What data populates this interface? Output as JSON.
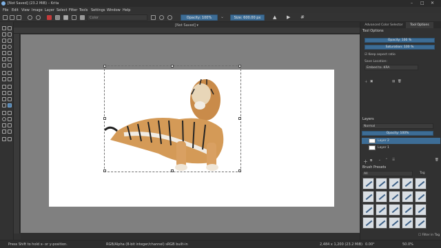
{
  "window": {
    "title": "[Not Saved]  (23.2 MiB)  – Krita",
    "minimize": "–",
    "maximize": "□",
    "close": "✕"
  },
  "menu": [
    "File",
    "Edit",
    "View",
    "Image",
    "Layer",
    "Select",
    "Filter",
    "Tools",
    "Settings",
    "Window",
    "Help"
  ],
  "toolbar": {
    "blend_mode": "Color",
    "opacity": "Opacity: 100%",
    "size": "Size: 600.00 px"
  },
  "document": {
    "tab_label": "[Not Saved] ▾"
  },
  "status": {
    "hint": "Press Shift to hold x- or y-position.",
    "color_info": "RGB/Alpha (8-bit integer/channel)  sRGB built-in",
    "dimensions": "2,484 x 1,200 (23.2 MiB)",
    "rotation": "0.00°",
    "zoom": "50.0%"
  },
  "dock": {
    "tabs": [
      "Advanced Color Selector",
      "Tool Options"
    ],
    "tool_options": {
      "title": "Tool Options",
      "opacity": "Opacity: 100 %",
      "saturation": "Saturation: 100 %",
      "keep_aspect": "Keep aspect ratio",
      "save_location_label": "Save Location:",
      "save_location": "Embed to .KRA"
    },
    "layers": {
      "title": "Layers",
      "blend": "Normal",
      "opacity": "Opacity: 100%",
      "items": [
        "Layer 2",
        "Layer 1"
      ]
    },
    "brush_presets": {
      "title": "Brush Presets",
      "filter": "All",
      "tag": "Tag",
      "filter_in_tag": "Filter in Tag"
    }
  }
}
